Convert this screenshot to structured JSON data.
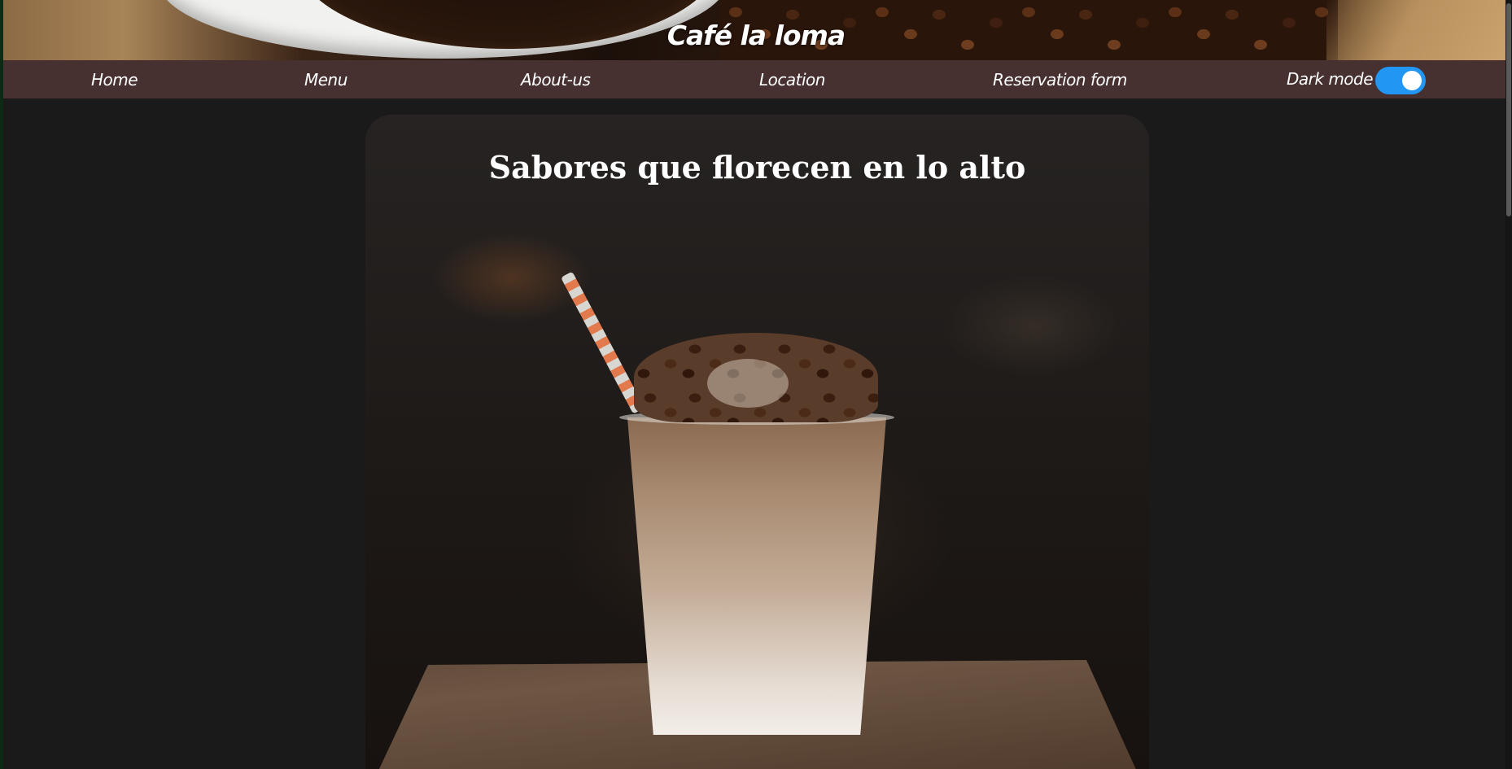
{
  "header": {
    "brand": "Café la loma"
  },
  "nav": {
    "items": [
      {
        "label": "Home"
      },
      {
        "label": "Menu"
      },
      {
        "label": "About-us"
      },
      {
        "label": "Location"
      },
      {
        "label": "Reservation form"
      }
    ],
    "dark_mode": {
      "label": "Dark mode",
      "enabled": true
    }
  },
  "hero": {
    "title": "Sabores que florecen en lo alto",
    "image_icon": "iced-coffee-photo"
  },
  "colors": {
    "page_background": "#1a1a1a",
    "navbar": "#473030",
    "toggle_on": "#2196f3",
    "text": "#ffffff"
  }
}
